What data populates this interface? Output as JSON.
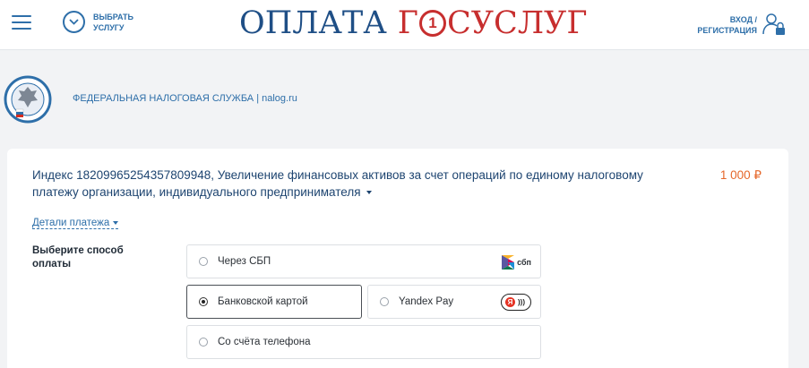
{
  "header": {
    "menu_icon": "hamburger-icon",
    "choose_service_label": "ВЫБРАТЬ УСЛУГУ",
    "logo_text_a": "ОПЛАТА",
    "logo_text_g": "Г",
    "logo_coin": "1",
    "logo_text_b": "СУСЛУГ",
    "login_label": "ВХОД / РЕГИСТРАЦИЯ",
    "brand_blue": "#1f4f86",
    "brand_red": "#c72e2e"
  },
  "organization": {
    "emblem_icon": "fns-emblem-icon",
    "name": "ФЕДЕРАЛЬНАЯ НАЛОГОВАЯ СЛУЖБА | nalog.ru"
  },
  "payment": {
    "purpose": "Индекс 18209965254357809948, Увеличение финансовых активов за счет операций по единому налоговому платежу организации, индивидуального предпринимателя",
    "amount": "1 000 ₽",
    "amount_color": "#e5672a",
    "details_label": "Детали платежа"
  },
  "methods": {
    "title": "Выберите способ оплаты",
    "selected": "card",
    "options": {
      "sbp": {
        "label": "Через СБП",
        "logo_text": "сбп"
      },
      "card": {
        "label": "Банковской картой"
      },
      "yandex": {
        "label": "Yandex Pay",
        "badge": "Я"
      },
      "phone": {
        "label": "Со счёта телефона"
      }
    }
  }
}
